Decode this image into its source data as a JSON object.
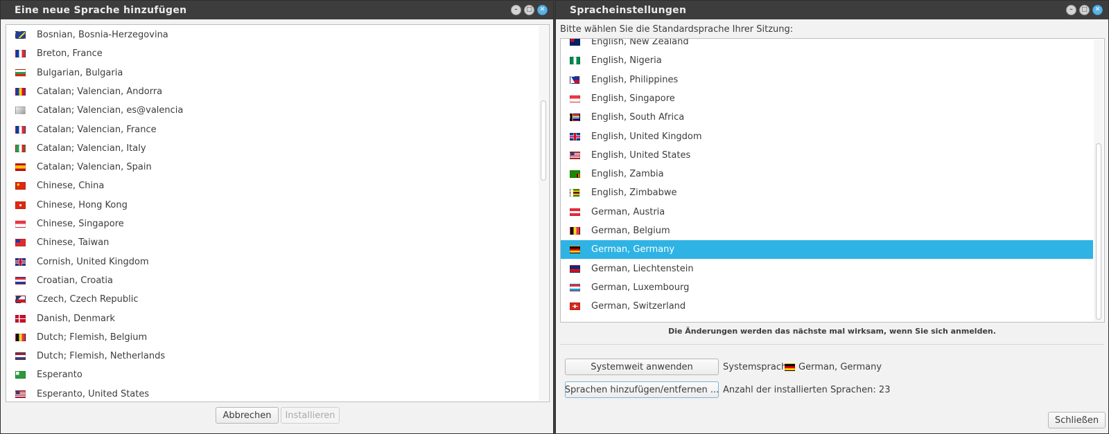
{
  "left_window": {
    "title": "Eine neue Sprache hinzufügen",
    "items": [
      {
        "label": "Bosnian, Bosnia-Herzegovina",
        "flag": "ba"
      },
      {
        "label": "Breton, France",
        "flag": "fr"
      },
      {
        "label": "Bulgarian, Bulgaria",
        "flag": "bg"
      },
      {
        "label": "Catalan; Valencian, Andorra",
        "flag": "ad"
      },
      {
        "label": "Catalan; Valencian, es@valencia",
        "flag": "none"
      },
      {
        "label": "Catalan; Valencian, France",
        "flag": "fr"
      },
      {
        "label": "Catalan; Valencian, Italy",
        "flag": "it"
      },
      {
        "label": "Catalan; Valencian, Spain",
        "flag": "es"
      },
      {
        "label": "Chinese, China",
        "flag": "cn"
      },
      {
        "label": "Chinese, Hong Kong",
        "flag": "hk"
      },
      {
        "label": "Chinese, Singapore",
        "flag": "sg"
      },
      {
        "label": "Chinese, Taiwan",
        "flag": "tw"
      },
      {
        "label": "Cornish, United Kingdom",
        "flag": "gb"
      },
      {
        "label": "Croatian, Croatia",
        "flag": "hr"
      },
      {
        "label": "Czech, Czech Republic",
        "flag": "cz"
      },
      {
        "label": "Danish, Denmark",
        "flag": "dk"
      },
      {
        "label": "Dutch; Flemish, Belgium",
        "flag": "be"
      },
      {
        "label": "Dutch; Flemish, Netherlands",
        "flag": "nl"
      },
      {
        "label": "Esperanto",
        "flag": "eo"
      },
      {
        "label": "Esperanto, United States",
        "flag": "us"
      }
    ],
    "cancel_label": "Abbrechen",
    "install_label": "Installieren"
  },
  "right_window": {
    "title": "Spracheinstellungen",
    "prompt": "Bitte wählen Sie die Standardsprache Ihrer Sitzung:",
    "items": [
      {
        "label": "English, New Zealand",
        "flag": "nz"
      },
      {
        "label": "English, Nigeria",
        "flag": "ng"
      },
      {
        "label": "English, Philippines",
        "flag": "ph"
      },
      {
        "label": "English, Singapore",
        "flag": "sg"
      },
      {
        "label": "English, South Africa",
        "flag": "za"
      },
      {
        "label": "English, United Kingdom",
        "flag": "gb"
      },
      {
        "label": "English, United States",
        "flag": "us"
      },
      {
        "label": "English, Zambia",
        "flag": "zm"
      },
      {
        "label": "English, Zimbabwe",
        "flag": "zw"
      },
      {
        "label": "German, Austria",
        "flag": "at"
      },
      {
        "label": "German, Belgium",
        "flag": "be"
      },
      {
        "label": "German, Germany",
        "flag": "de",
        "selected": true
      },
      {
        "label": "German, Liechtenstein",
        "flag": "li"
      },
      {
        "label": "German, Luxembourg",
        "flag": "lu"
      },
      {
        "label": "German, Switzerland",
        "flag": "ch"
      }
    ],
    "notice": "Die Änderungen werden das nächste mal wirksam, wenn Sie sich anmelden.",
    "apply_system_label": "Systemweit anwenden",
    "system_language_label": "Systemsprache",
    "system_language_value": "German, Germany",
    "system_language_flag": "de",
    "add_remove_label": "Sprachen hinzufügen/entfernen ...",
    "installed_count_text": "Anzahl der installierten Sprachen: 23",
    "close_label": "Schließen"
  },
  "selection_color": "#2eb3e4"
}
